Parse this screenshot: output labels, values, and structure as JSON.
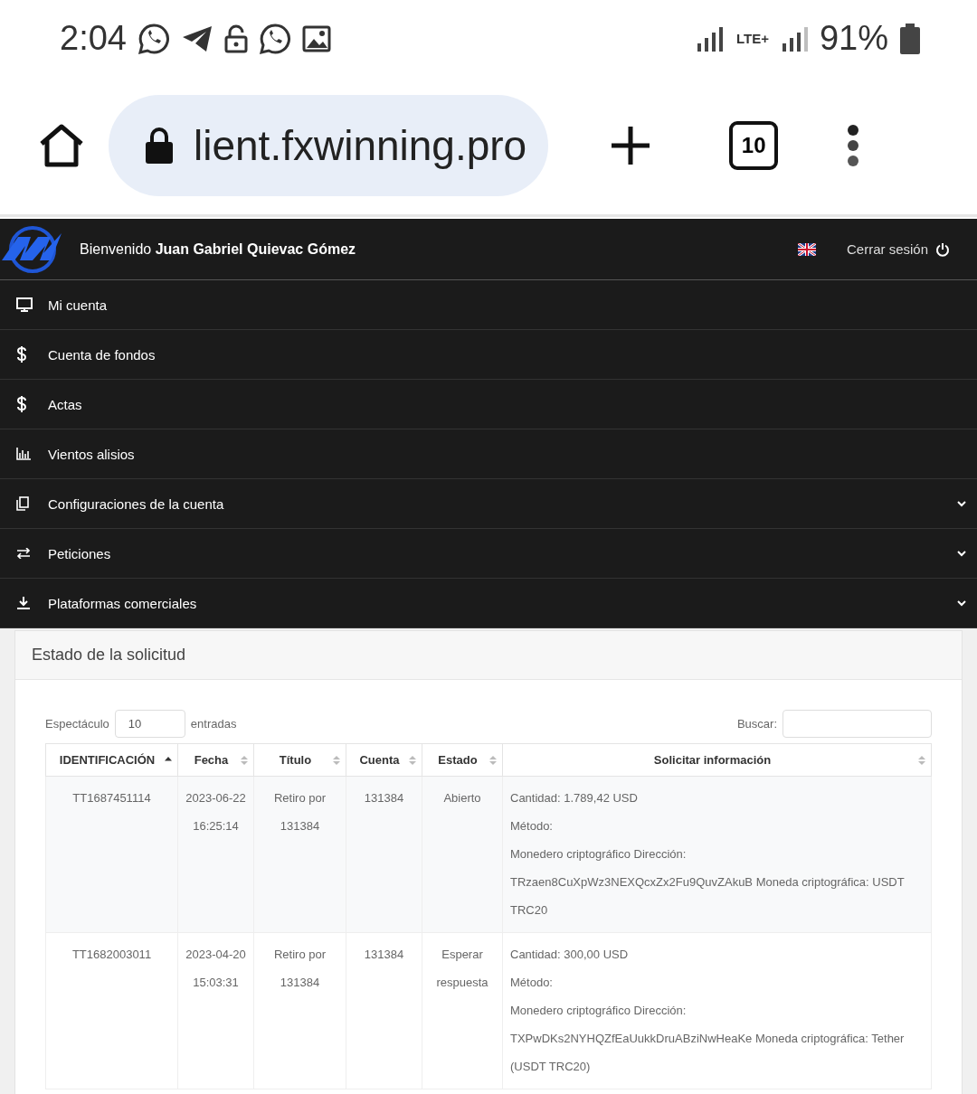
{
  "status_bar": {
    "time": "2:04",
    "network": "LTE+",
    "battery": "91%"
  },
  "browser": {
    "url": "lient.fxwinning.pro",
    "tab_count": "10"
  },
  "header": {
    "greeting": "Bienvenido **Juan Gabriel Quievac Gómez**",
    "logout": "Cerrar sesión"
  },
  "menu": [
    {
      "label": "Mi cuenta",
      "has_submenu": false
    },
    {
      "label": "Cuenta de fondos",
      "has_submenu": false
    },
    {
      "label": "Actas",
      "has_submenu": false
    },
    {
      "label": "Vientos alisios",
      "has_submenu": false
    },
    {
      "label": "Configuraciones de la cuenta",
      "has_submenu": true
    },
    {
      "label": "Peticiones",
      "has_submenu": true
    },
    {
      "label": "Plataformas comerciales",
      "has_submenu": true
    }
  ],
  "panel": {
    "title": "Estado de la solicitud",
    "length_label": "Espectáculo",
    "length_value": "10",
    "entries_label": "entradas",
    "search_label": "Buscar:",
    "columns": [
      {
        "label": "IDENTIFICACIÓN",
        "sorted": true
      },
      {
        "label": "Fecha",
        "sorted": false
      },
      {
        "label": "Título",
        "sorted": false
      },
      {
        "label": "Cuenta",
        "sorted": false
      },
      {
        "label": "Estado",
        "sorted": false
      },
      {
        "label": "Solicitar información",
        "sorted": false
      }
    ],
    "rows": [
      {
        "cells": [
          "TT1687451114",
          "2023-06-22 16:25:14",
          "Retiro por 131384",
          "131384",
          "Abierto"
        ],
        "info": [
          "Cantidad: 1.789,42 USD",
          "Método:",
          "Monedero criptográfico Dirección: TRzaen8CuXpWz3NEXQcxZx2Fu9QuvZAkuB Moneda criptográfica: USDT TRC20"
        ]
      },
      {
        "cells": [
          "TT1682003011",
          "2023-04-20 15:03:31",
          "Retiro por 131384",
          "131384",
          "Esperar respuesta"
        ],
        "info": [
          "Cantidad: 300,00 USD",
          "Método:",
          "Monedero criptográfico Dirección: TXPwDKs2NYHQZfEaUukkDruABziNwHeaKe Moneda criptográfica: Tether (USDT TRC20)"
        ]
      }
    ]
  }
}
